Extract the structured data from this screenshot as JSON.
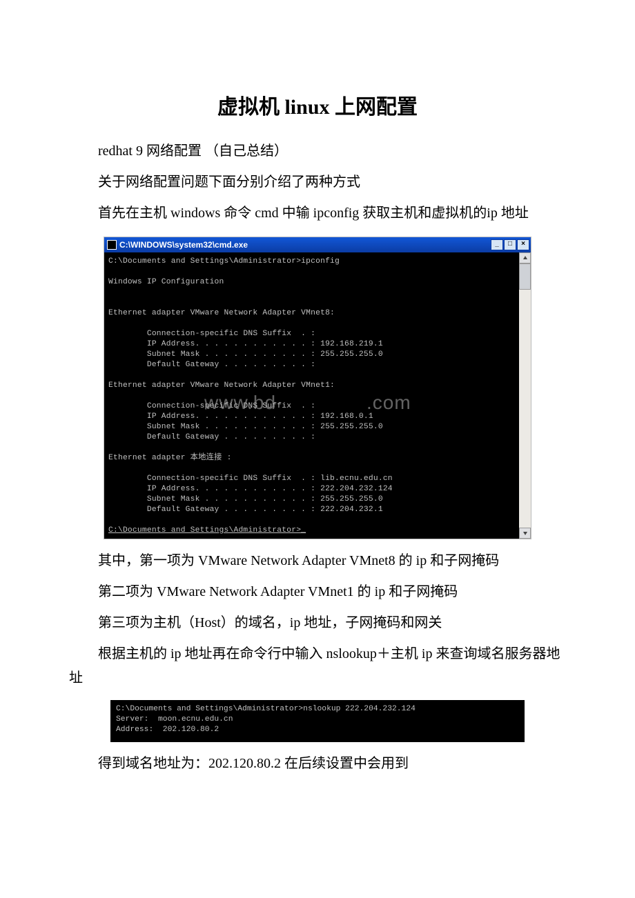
{
  "title": "虚拟机 linux 上网配置",
  "p1": "redhat 9 网络配置 （自己总结）",
  "p2": "关于网络配置问题下面分别介绍了两种方式",
  "p3": "首先在主机 windows 命令 cmd 中输 ipconfig 获取主机和虚拟机的ip 地址",
  "cmd1": {
    "title": "C:\\WINDOWS\\system32\\cmd.exe",
    "btn_min": "_",
    "btn_max": "□",
    "btn_close": "×",
    "lines": {
      "l1": "C:\\Documents and Settings\\Administrator>ipconfig",
      "l2": "Windows IP Configuration",
      "l3": "Ethernet adapter VMware Network Adapter VMnet8:",
      "l4": "        Connection-specific DNS Suffix  . :",
      "l5": "        IP Address. . . . . . . . . . . . : 192.168.219.1",
      "l6": "        Subnet Mask . . . . . . . . . . . : 255.255.255.0",
      "l7": "        Default Gateway . . . . . . . . . :",
      "l8": "Ethernet adapter VMware Network Adapter VMnet1:",
      "l9": "        Connection-specific DNS Suffix  . :",
      "l10": "        IP Address. . . . . . . . . . . . : 192.168.0.1",
      "l11": "        Subnet Mask . . . . . . . . . . . : 255.255.255.0",
      "l12": "        Default Gateway . . . . . . . . . :",
      "l13": "Ethernet adapter 本地连接 :",
      "l14": "        Connection-specific DNS Suffix  . : lib.ecnu.edu.cn",
      "l15": "        IP Address. . . . . . . . . . . . : 222.204.232.124",
      "l16": "        Subnet Mask . . . . . . . . . . . : 255.255.255.0",
      "l17": "        Default Gateway . . . . . . . . . : 222.204.232.1",
      "l18": "C:\\Documents and Settings\\Administrator>_"
    },
    "watermark_left": "www.bd",
    "watermark_right": ".com"
  },
  "p4": "其中，第一项为 VMware Network Adapter VMnet8 的 ip 和子网掩码",
  "p5": "  第二项为 VMware Network Adapter VMnet1 的 ip 和子网掩码",
  "p6": "第三项为主机（Host）的域名，ip 地址，子网掩码和网关",
  "p7": "根据主机的 ip 地址再在命令行中输入 nslookup＋主机 ip 来查询域名服务器地址",
  "ns": {
    "l1": "C:\\Documents and Settings\\Administrator>nslookup 222.204.232.124",
    "l2": "Server:  moon.ecnu.edu.cn",
    "l3": "Address:  202.120.80.2"
  },
  "p8": "得到域名地址为：202.120.80.2 在后续设置中会用到"
}
